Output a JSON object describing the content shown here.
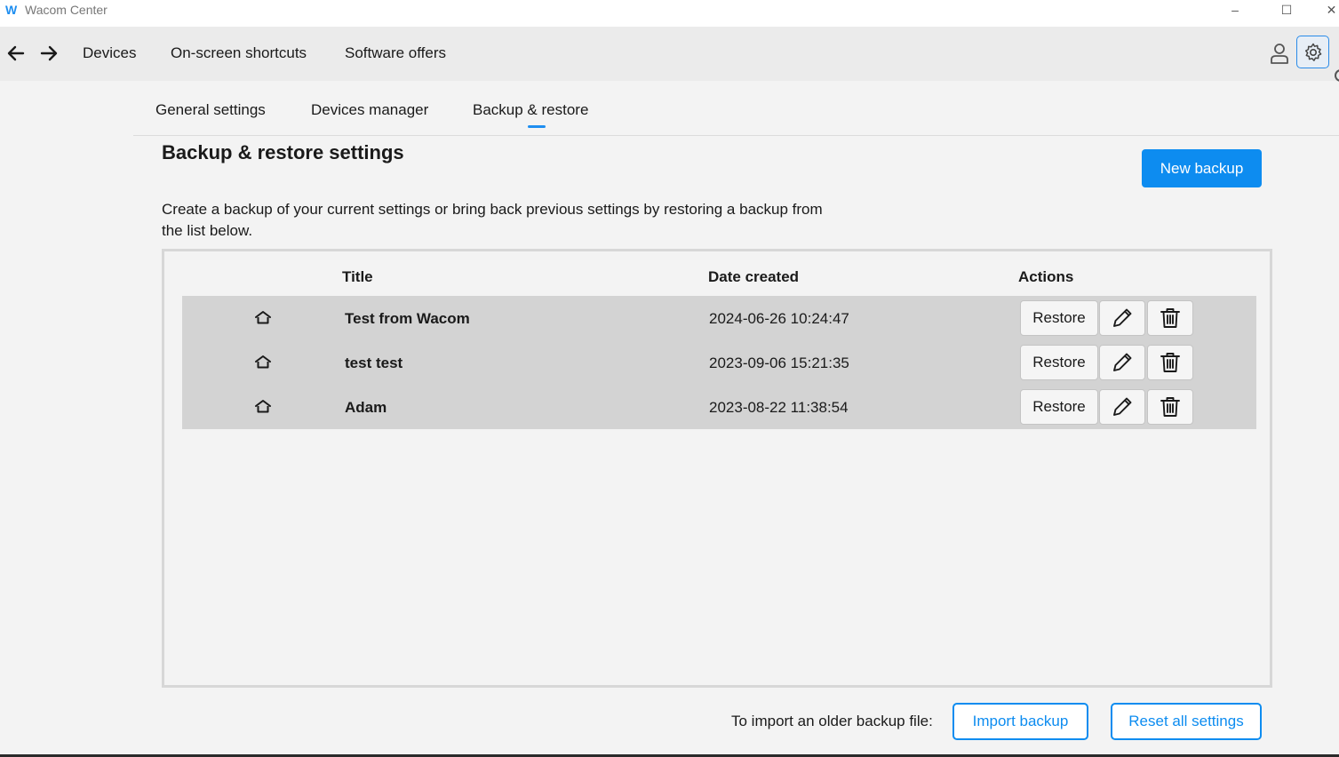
{
  "window": {
    "logo": "W",
    "title": "Wacom Center",
    "minimize": "–",
    "maximize": "☐",
    "close": "✕"
  },
  "topnav": {
    "back_icon": "arrow-left-icon",
    "forward_icon": "arrow-right-icon",
    "links": [
      "Devices",
      "On-screen shortcuts",
      "Software offers"
    ],
    "user_icon": "user-icon",
    "settings_icon": "gear-icon"
  },
  "subtabs": {
    "items": [
      "General settings",
      "Devices manager",
      "Backup & restore"
    ],
    "active": "Backup & restore"
  },
  "page": {
    "title": "Backup & restore settings",
    "new_backup_label": "New backup",
    "description": "Create a backup of your current settings or bring back previous settings by restoring a backup from the list below."
  },
  "table": {
    "headers": {
      "title": "Title",
      "date": "Date created",
      "actions": "Actions"
    },
    "rows": [
      {
        "icon": "home-icon",
        "title": "Test from Wacom",
        "date": "2024-06-26 10:24:47",
        "restore": "Restore"
      },
      {
        "icon": "home-icon",
        "title": "test test",
        "date": "2023-09-06 15:21:35",
        "restore": "Restore"
      },
      {
        "icon": "home-icon",
        "title": "Adam",
        "date": "2023-08-22 11:38:54",
        "restore": "Restore"
      }
    ]
  },
  "footer": {
    "import_label": "To import an older backup file:",
    "import_button": "Import backup",
    "reset_button": "Reset all settings"
  },
  "colors": {
    "accent": "#0d8cf0",
    "row_background": "#d3d3d3",
    "page_background": "#f3f3f3"
  }
}
